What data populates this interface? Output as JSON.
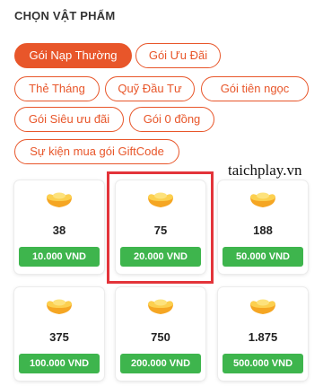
{
  "section": {
    "title": "CHỌN VẬT PHẨM"
  },
  "tabs": [
    {
      "label": "Gói Nạp Thường",
      "active": true
    },
    {
      "label": "Gói Ưu Đãi"
    },
    {
      "label": "Thẻ Tháng"
    },
    {
      "label": "Quỹ Đầu Tư"
    },
    {
      "label": "Gói tiên ngọc"
    },
    {
      "label": "Gói Siêu ưu đãi"
    },
    {
      "label": "Gói 0 đồng"
    },
    {
      "label": "Sự kiện mua gói GiftCode"
    }
  ],
  "packages": [
    {
      "amount": "38",
      "price": "10.000 VND"
    },
    {
      "amount": "75",
      "price": "20.000 VND",
      "highlighted": true
    },
    {
      "amount": "188",
      "price": "50.000 VND"
    },
    {
      "amount": "375",
      "price": "100.000 VND"
    },
    {
      "amount": "750",
      "price": "200.000 VND"
    },
    {
      "amount": "1.875",
      "price": "500.000 VND"
    }
  ],
  "watermark": "taichplay.vn",
  "icons": {
    "package_icon": "gold-ingot-icon"
  },
  "colors": {
    "accent": "#e8562a",
    "price_bg": "#3eb54d",
    "highlight_border": "#e3343a",
    "ingot_gold": "#f5a623"
  }
}
